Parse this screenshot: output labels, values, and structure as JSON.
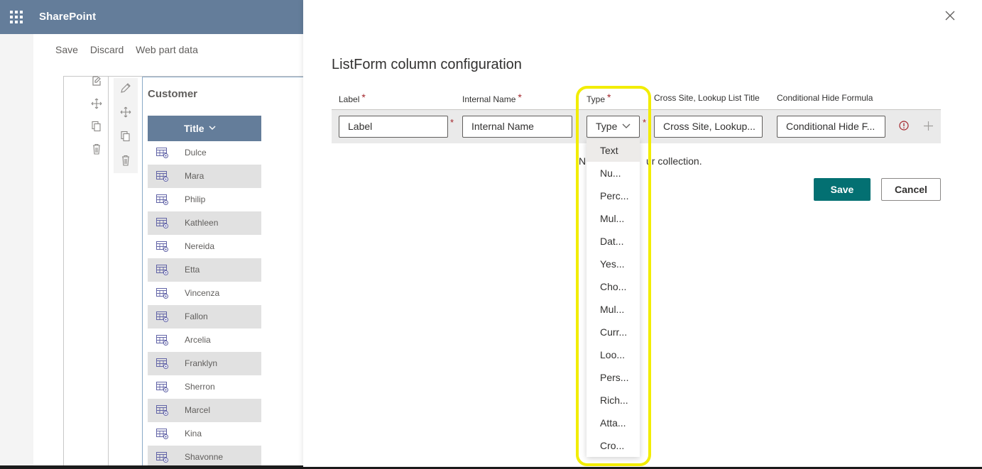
{
  "header": {
    "brand": "SharePoint"
  },
  "commandbar": {
    "save": "Save",
    "discard": "Discard",
    "webpart_data": "Web part data"
  },
  "webpart": {
    "title": "Customer",
    "column_header": "Title",
    "rows": [
      "Dulce",
      "Mara",
      "Philip",
      "Kathleen",
      "Nereida",
      "Etta",
      "Vincenza",
      "Fallon",
      "Arcelia",
      "Franklyn",
      "Sherron",
      "Marcel",
      "Kina",
      "Shavonne"
    ]
  },
  "panel": {
    "title": "ListForm column configuration",
    "headers": {
      "label": "Label",
      "internal_name": "Internal Name",
      "type": "Type",
      "lookup": "Cross Site, Lookup List Title",
      "hide_formula": "Conditional Hide Formula"
    },
    "required_mark": "*",
    "inputs": {
      "label": "Label",
      "internal_name": "Internal Name",
      "type": "Type",
      "lookup": "Cross Site, Lookup...",
      "hide_formula": "Conditional Hide F..."
    },
    "empty_left": "N",
    "empty_right": "ur collection.",
    "save": "Save",
    "cancel": "Cancel"
  },
  "type_options": [
    "Text",
    "Nu...",
    "Perc...",
    "Mul...",
    "Dat...",
    "Yes...",
    "Cho...",
    "Mul...",
    "Curr...",
    "Loo...",
    "Pers...",
    "Rich...",
    "Atta...",
    "Cro..."
  ],
  "colors": {
    "header_bg": "#647d9a",
    "save_bg": "#037072",
    "highlight": "#f2ed00",
    "required": "#a4262c"
  }
}
